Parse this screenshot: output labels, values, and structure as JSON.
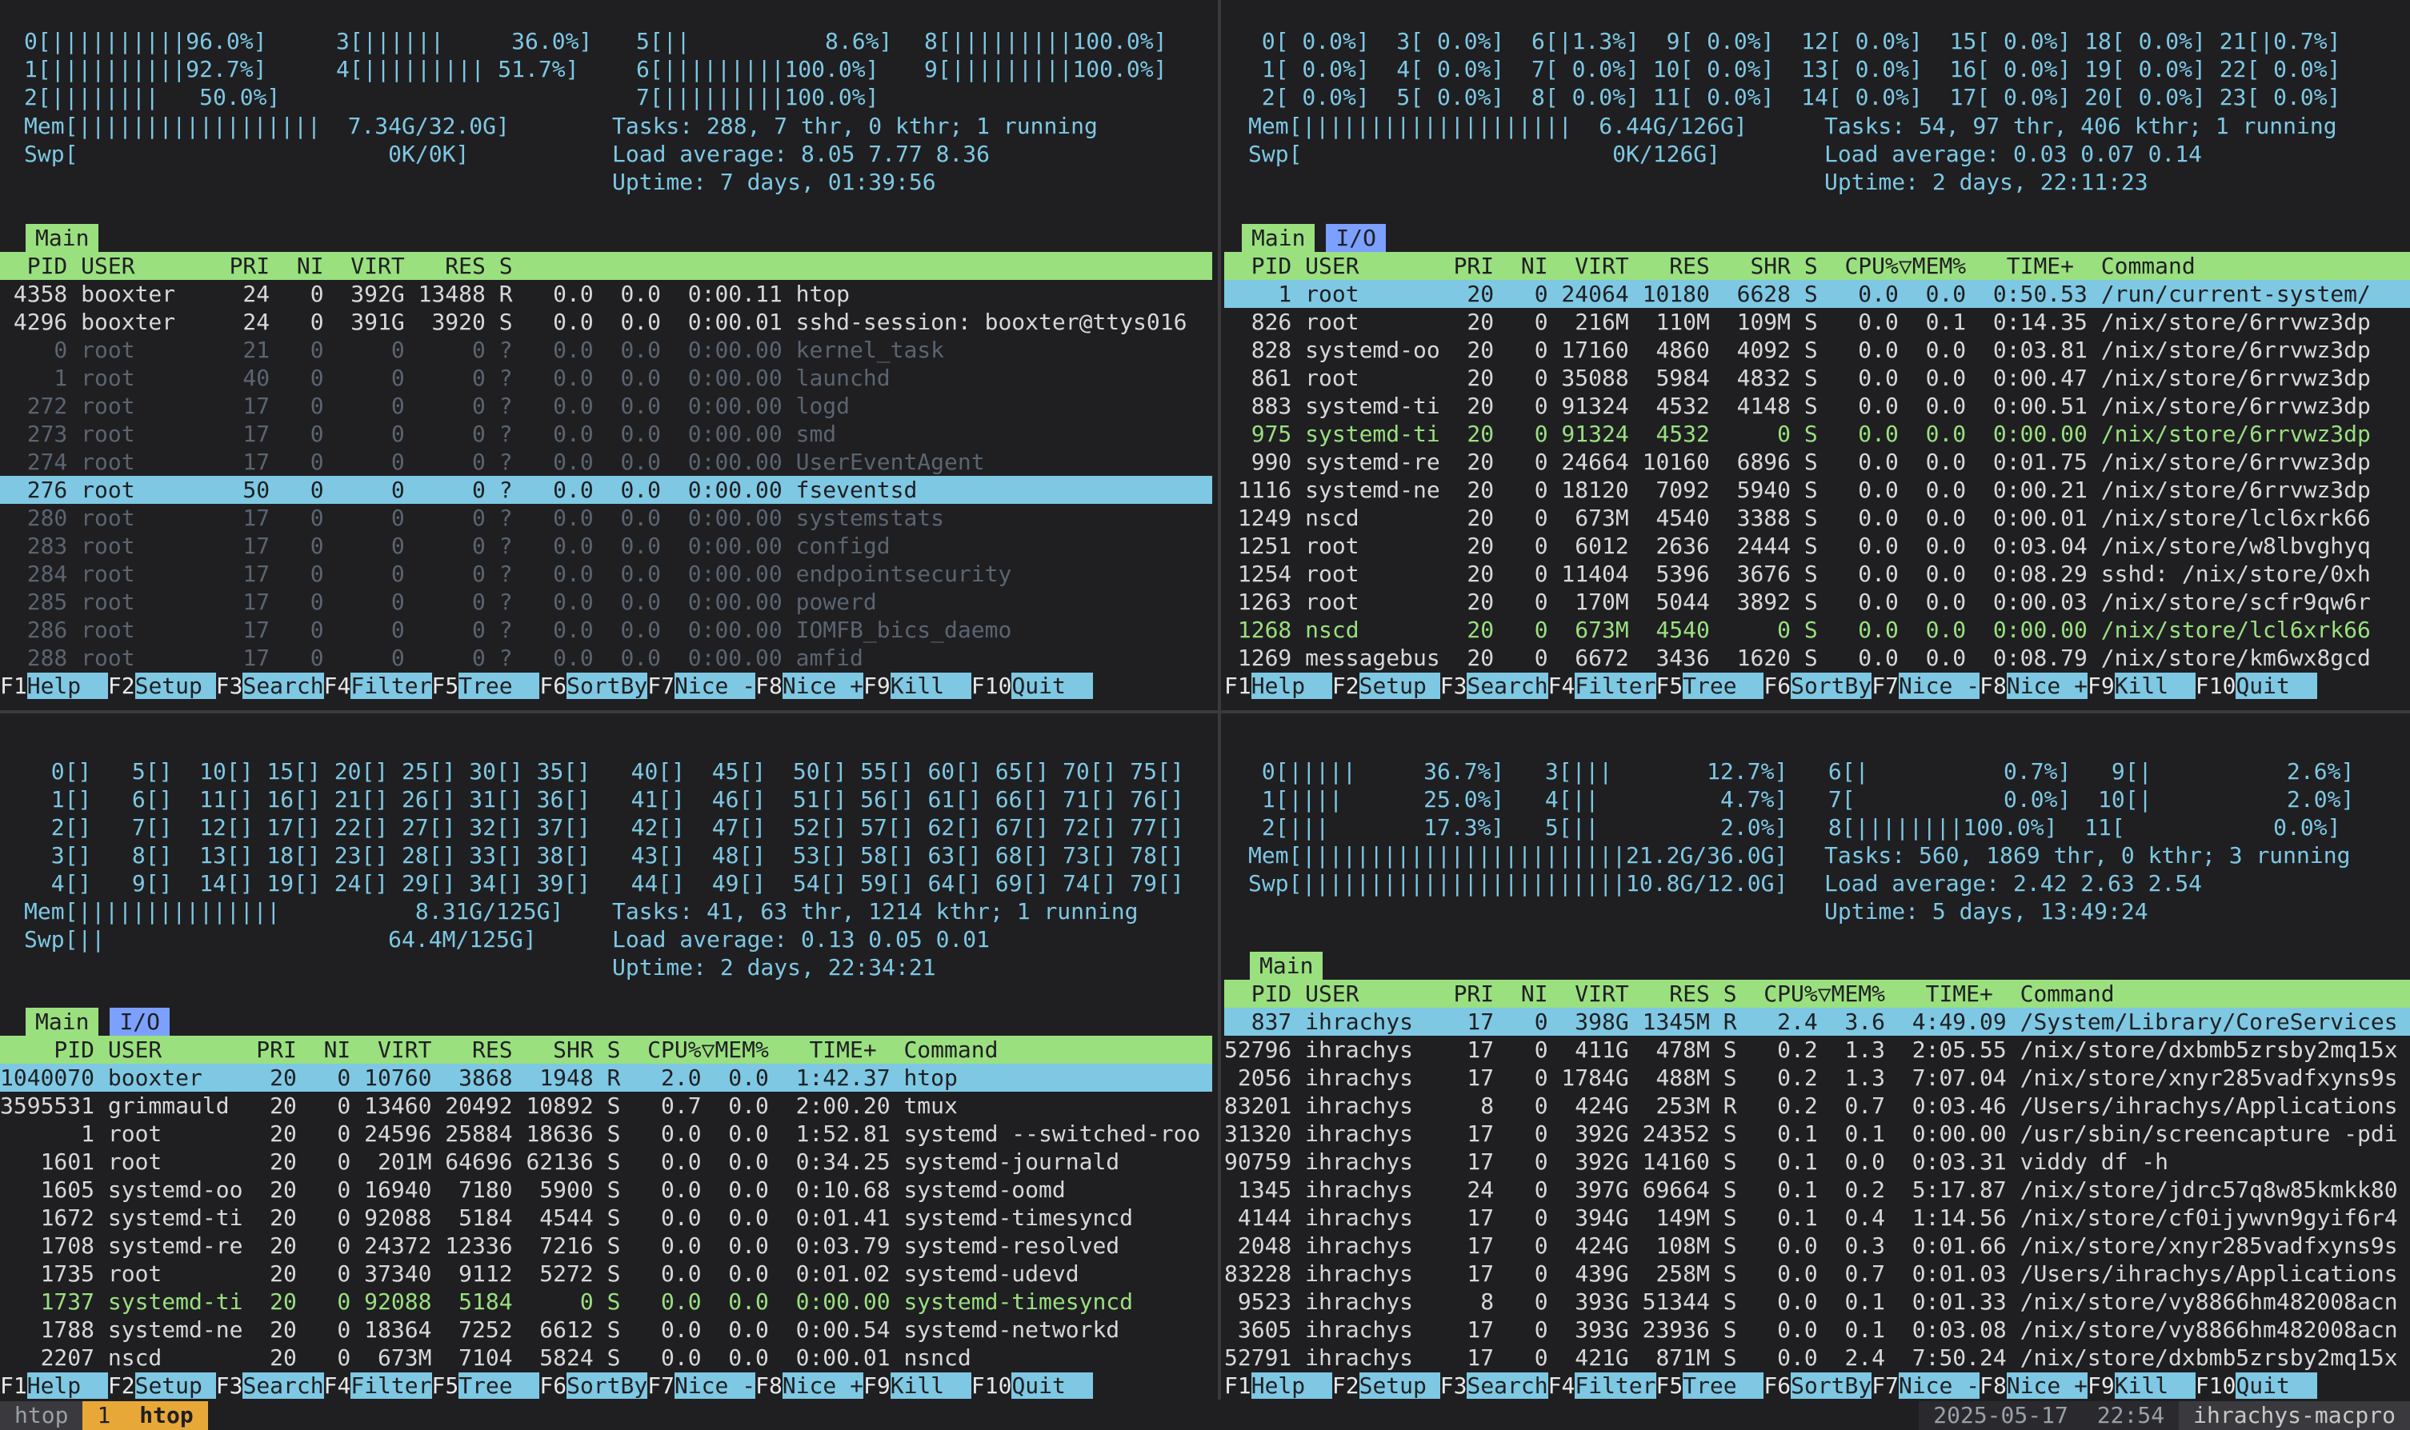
{
  "pane1": {
    "cpu": [
      "0[||||||||||96.0%]",
      "1[||||||||||92.7%]",
      "2[||||||||   50.0%]",
      "3[||||||     36.0%]",
      "4[||||||||| 51.7%]",
      "5[||          8.6%]",
      "6[|||||||||100.0%]",
      "7[|||||||||100.0%]",
      "8[|||||||||100.0%]",
      "9[|||||||||100.0%]"
    ],
    "mem": "Mem[||||||||||||||||||  7.34G/32.0G]",
    "swp": "Swp[                       0K/0K]",
    "tasks": "Tasks: 288, 7 thr, 0 kthr; 1 running",
    "load": "Load average: 8.05 7.77 8.36",
    "uptime": "Uptime: 7 days, 01:39:56",
    "tab_main": "Main",
    "header": "  PID USER       PRI  NI  VIRT   RES S",
    "rows": [
      " 4358 booxter     24   0  392G 13488 R   0.0  0.0  0:00.11 htop",
      " 4296 booxter     24   0  391G  3920 S   0.0  0.0  0:00.01 sshd-session: booxter@ttys016",
      "    0 root        21   0     0     0 ?   0.0  0.0  0:00.00 kernel_task",
      "    1 root        40   0     0     0 ?   0.0  0.0  0:00.00 launchd",
      "  272 root        17   0     0     0 ?   0.0  0.0  0:00.00 logd",
      "  273 root        17   0     0     0 ?   0.0  0.0  0:00.00 smd",
      "  274 root        17   0     0     0 ?   0.0  0.0  0:00.00 UserEventAgent",
      "  276 root        50   0     0     0 ?   0.0  0.0  0:00.00 fseventsd",
      "  280 root        17   0     0     0 ?   0.0  0.0  0:00.00 systemstats",
      "  283 root        17   0     0     0 ?   0.0  0.0  0:00.00 configd",
      "  284 root        17   0     0     0 ?   0.0  0.0  0:00.00 endpointsecurity",
      "  285 root        17   0     0     0 ?   0.0  0.0  0:00.00 powerd",
      "  286 root        17   0     0     0 ?   0.0  0.0  0:00.00 IOMFB_bics_daemo",
      "  288 root        17   0     0     0 ?   0.0  0.0  0:00.00 amfid"
    ]
  },
  "pane2": {
    "cpu": [
      " 0[ 0.0%]  3[ 0.0%]  6[|1.3%]  9[ 0.0%]  12[ 0.0%]  15[ 0.0%] 18[ 0.0%] 21[|0.7%]",
      " 1[ 0.0%]  4[ 0.0%]  7[ 0.0%] 10[ 0.0%]  13[ 0.0%]  16[ 0.0%] 19[ 0.0%] 22[ 0.0%]",
      " 2[ 0.0%]  5[ 0.0%]  8[ 0.0%] 11[ 0.0%]  14[ 0.0%]  17[ 0.0%] 20[ 0.0%] 23[ 0.0%]"
    ],
    "mem": "Mem[||||||||||||||||||||  6.44G/126G]",
    "swp": "Swp[                       0K/126G]",
    "tasks": "Tasks: 54, 97 thr, 406 kthr; 1 running",
    "load": "Load average: 0.03 0.07 0.14",
    "uptime": "Uptime: 2 days, 22:11:23",
    "tab_main": "Main",
    "tab_io": "I/O",
    "header": "  PID USER       PRI  NI  VIRT   RES   SHR S  CPU%▽MEM%   TIME+  Command",
    "rows": [
      "    1 root        20   0 24064 10180  6628 S   0.0  0.0  0:50.53 /run/current-system/",
      "  826 root        20   0  216M  110M  109M S   0.0  0.1  0:14.35 /nix/store/6rrvwz3dp",
      "  828 systemd-oo  20   0 17160  4860  4092 S   0.0  0.0  0:03.81 /nix/store/6rrvwz3dp",
      "  861 root        20   0 35088  5984  4832 S   0.0  0.0  0:00.47 /nix/store/6rrvwz3dp",
      "  883 systemd-ti  20   0 91324  4532  4148 S   0.0  0.0  0:00.51 /nix/store/6rrvwz3dp",
      "  975 systemd-ti  20   0 91324  4532     0 S   0.0  0.0  0:00.00 /nix/store/6rrvwz3dp",
      "  990 systemd-re  20   0 24664 10160  6896 S   0.0  0.0  0:01.75 /nix/store/6rrvwz3dp",
      " 1116 systemd-ne  20   0 18120  7092  5940 S   0.0  0.0  0:00.21 /nix/store/6rrvwz3dp",
      " 1249 nscd        20   0  673M  4540  3388 S   0.0  0.0  0:00.01 /nix/store/lcl6xrk66",
      " 1251 root        20   0  6012  2636  2444 S   0.0  0.0  0:03.04 /nix/store/w8lbvghyq",
      " 1254 root        20   0 11404  5396  3676 S   0.0  0.0  0:08.29 sshd: /nix/store/0xh",
      " 1263 root        20   0  170M  5044  3892 S   0.0  0.0  0:00.03 /nix/store/scfr9qw6r",
      " 1268 nscd        20   0  673M  4540     0 S   0.0  0.0  0:00.00 /nix/store/lcl6xrk66",
      " 1269 messagebus  20   0  6672  3436  1620 S   0.0  0.0  0:08.79 /nix/store/km6wx8gcd"
    ]
  },
  "pane3": {
    "cpu": [
      "  0[]   5[]  10[] 15[] 20[] 25[] 30[] 35[]   40[]  45[]  50[] 55[] 60[] 65[] 70[] 75[]",
      "  1[]   6[]  11[] 16[] 21[] 26[] 31[] 36[]   41[]  46[]  51[] 56[] 61[] 66[] 71[] 76[]",
      "  2[]   7[]  12[] 17[] 22[] 27[] 32[] 37[]   42[]  47[]  52[] 57[] 62[] 67[] 72[] 77[]",
      "  3[]   8[]  13[] 18[] 23[] 28[] 33[] 38[]   43[]  48[]  53[] 58[] 63[] 68[] 73[] 78[]",
      "  4[]   9[]  14[] 19[] 24[] 29[] 34[] 39[]   44[]  49[]  54[] 59[] 64[] 69[] 74[] 79[]"
    ],
    "mem": "Mem[|||||||||||||||          8.31G/125G]",
    "swp": "Swp[||                     64.4M/125G]",
    "tasks": "Tasks: 41, 63 thr, 1214 kthr; 1 running",
    "load": "Load average: 0.13 0.05 0.01",
    "uptime": "Uptime: 2 days, 22:34:21",
    "tab_main": "Main",
    "tab_io": "I/O",
    "header": "    PID USER       PRI  NI  VIRT   RES   SHR S  CPU%▽MEM%   TIME+  Command",
    "rows": [
      "1040070 booxter     20   0 10760  3868  1948 R   2.0  0.0  1:42.37 htop",
      "3595531 grimmauld   20   0 13460 20492 10892 S   0.7  0.0  2:00.20 tmux",
      "      1 root        20   0 24596 25884 18636 S   0.0  0.0  1:52.81 systemd --switched-roo",
      "   1601 root        20   0  201M 64696 62136 S   0.0  0.0  0:34.25 systemd-journald",
      "   1605 systemd-oo  20   0 16940  7180  5900 S   0.0  0.0  0:10.68 systemd-oomd",
      "   1672 systemd-ti  20   0 92088  5184  4544 S   0.0  0.0  0:01.41 systemd-timesyncd",
      "   1708 systemd-re  20   0 24372 12336  7216 S   0.0  0.0  0:03.79 systemd-resolved",
      "   1735 root        20   0 37340  9112  5272 S   0.0  0.0  0:01.02 systemd-udevd",
      "   1737 systemd-ti  20   0 92088  5184     0 S   0.0  0.0  0:00.00 systemd-timesyncd",
      "   1788 systemd-ne  20   0 18364  7252  6612 S   0.0  0.0  0:00.54 systemd-networkd",
      "   2207 nscd        20   0  673M  7104  5824 S   0.0  0.0  0:00.01 nsncd"
    ]
  },
  "pane4": {
    "cpu": [
      " 0[|||||     36.7%]   3[|||       12.7%]   6[|          0.7%]   9[|          2.6%]",
      " 1[||||      25.0%]   4[||         4.7%]   7[           0.0%]  10[|          2.0%]",
      " 2[|||       17.3%]   5[||         2.0%]   8[||||||||100.0%]  11[           0.0%]"
    ],
    "mem": "Mem[||||||||||||||||||||||||21.2G/36.0G]",
    "swp": "Swp[||||||||||||||||||||||||10.8G/12.0G]",
    "tasks": "Tasks: 560, 1869 thr, 0 kthr; 3 running",
    "load": "Load average: 2.42 2.63 2.54",
    "uptime": "Uptime: 5 days, 13:49:24",
    "tab_main": "Main",
    "header": "  PID USER       PRI  NI  VIRT   RES S  CPU%▽MEM%   TIME+  Command",
    "rows": [
      "  837 ihrachys    17   0  398G 1345M R   2.4  3.6  4:49.09 /System/Library/CoreServices",
      "52796 ihrachys    17   0  411G  478M S   0.2  1.3  2:05.55 /nix/store/dxbmb5zrsby2mq15x",
      " 2056 ihrachys    17   0 1784G  488M S   0.2  1.3  7:07.04 /nix/store/xnyr285vadfxyns9s",
      "83201 ihrachys     8   0  424G  253M R   0.2  0.7  0:03.46 /Users/ihrachys/Applications",
      "31320 ihrachys    17   0  392G 24352 S   0.1  0.1  0:00.00 /usr/sbin/screencapture -pdi",
      "90759 ihrachys    17   0  392G 14160 S   0.1  0.0  0:03.31 viddy df -h",
      " 1345 ihrachys    24   0  397G 69664 S   0.1  0.2  5:17.87 /nix/store/jdrc57q8w85kmkk80",
      " 4144 ihrachys    17   0  394G  149M S   0.1  0.4  1:14.56 /nix/store/cf0ijywvn9gyif6r4",
      " 2048 ihrachys    17   0  424G  108M S   0.0  0.3  0:01.66 /nix/store/xnyr285vadfxyns9s",
      "83228 ihrachys    17   0  439G  258M S   0.0  0.7  0:01.03 /Users/ihrachys/Applications",
      " 9523 ihrachys     8   0  393G 51344 S   0.0  0.1  0:01.33 /nix/store/vy8866hm482008acn",
      " 3605 ihrachys    17   0  393G 23936 S   0.0  0.1  0:03.08 /nix/store/vy8866hm482008acn",
      "52791 ihrachys    17   0  421G  871M S   0.0  2.4  7:50.24 /nix/store/dxbmb5zrsby2mq15x"
    ]
  },
  "fkeys": [
    {
      "k": "F1",
      "l": "Help  "
    },
    {
      "k": "F2",
      "l": "Setup "
    },
    {
      "k": "F3",
      "l": "Search"
    },
    {
      "k": "F4",
      "l": "Filter"
    },
    {
      "k": "F5",
      "l": "Tree  "
    },
    {
      "k": "F6",
      "l": "SortBy"
    },
    {
      "k": "F7",
      "l": "Nice -"
    },
    {
      "k": "F8",
      "l": "Nice +"
    },
    {
      "k": "F9",
      "l": "Kill  "
    },
    {
      "k": "F10",
      "l": "Quit  "
    }
  ],
  "statusbar": {
    "session": "htop",
    "window_index": "1",
    "window_name": "htop",
    "date": "2025-05-17",
    "time": "22:54",
    "host": "ihrachys-macpro"
  }
}
